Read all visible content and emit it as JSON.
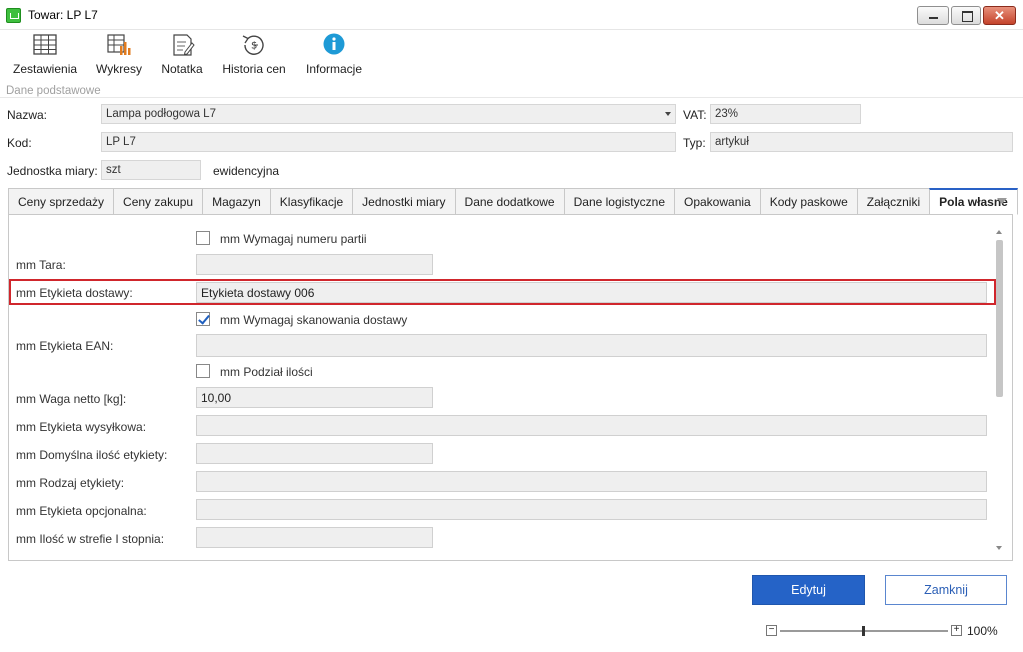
{
  "window": {
    "title": "Towar: LP L7"
  },
  "toolbar": {
    "items": [
      {
        "label": "Zestawienia",
        "icon": "table-icon"
      },
      {
        "label": "Wykresy",
        "icon": "chart-icon"
      },
      {
        "label": "Notatka",
        "icon": "note-icon"
      },
      {
        "label": "Historia cen",
        "icon": "price-history-icon"
      },
      {
        "label": "Informacje",
        "icon": "info-icon"
      }
    ]
  },
  "basic": {
    "section_label": "Dane podstawowe",
    "name_label": "Nazwa:",
    "name_value": "Lampa podłogowa L7",
    "vat_label": "VAT:",
    "vat_value": "23%",
    "code_label": "Kod:",
    "code_value": "LP L7",
    "type_label": "Typ:",
    "type_value": "artykuł",
    "unit_label": "Jednostka miary:",
    "unit_value": "szt",
    "unit_kind": "ewidencyjna"
  },
  "tabs": [
    {
      "label": "Ceny sprzedaży"
    },
    {
      "label": "Ceny zakupu"
    },
    {
      "label": "Magazyn"
    },
    {
      "label": "Klasyfikacje"
    },
    {
      "label": "Jednostki miary"
    },
    {
      "label": "Dane dodatkowe"
    },
    {
      "label": "Dane logistyczne"
    },
    {
      "label": "Opakowania"
    },
    {
      "label": "Kody paskowe"
    },
    {
      "label": "Załączniki"
    },
    {
      "label": "Pola własne",
      "active": true
    }
  ],
  "custom_fields": {
    "chk_batch": {
      "label": "mm Wymagaj numeru partii",
      "checked": false
    },
    "tara": {
      "label": "mm Tara:",
      "value": ""
    },
    "delivery_label": {
      "label": "mm Etykieta dostawy:",
      "value": "Etykieta dostawy 006"
    },
    "chk_scan": {
      "label": "mm Wymagaj skanowania dostawy",
      "checked": true
    },
    "ean_label": {
      "label": "mm Etykieta EAN:",
      "value": ""
    },
    "chk_split": {
      "label": "mm Podział ilości",
      "checked": false
    },
    "net_weight": {
      "label": "mm Waga netto [kg]:",
      "value": "10,00"
    },
    "shipping_label": {
      "label": "mm Etykieta wysyłkowa:",
      "value": ""
    },
    "default_label_qty": {
      "label": "mm Domyślna ilość etykiety:",
      "value": ""
    },
    "label_type": {
      "label": "mm Rodzaj etykiety:",
      "value": ""
    },
    "optional_label": {
      "label": "mm Etykieta opcjonalna:",
      "value": ""
    },
    "zone1_qty": {
      "label": "mm Ilość w strefie I stopnia:",
      "value": ""
    }
  },
  "buttons": {
    "edit": "Edytuj",
    "close": "Zamknij"
  },
  "zoom": {
    "value": "100%",
    "minus": "−",
    "plus": "+"
  }
}
